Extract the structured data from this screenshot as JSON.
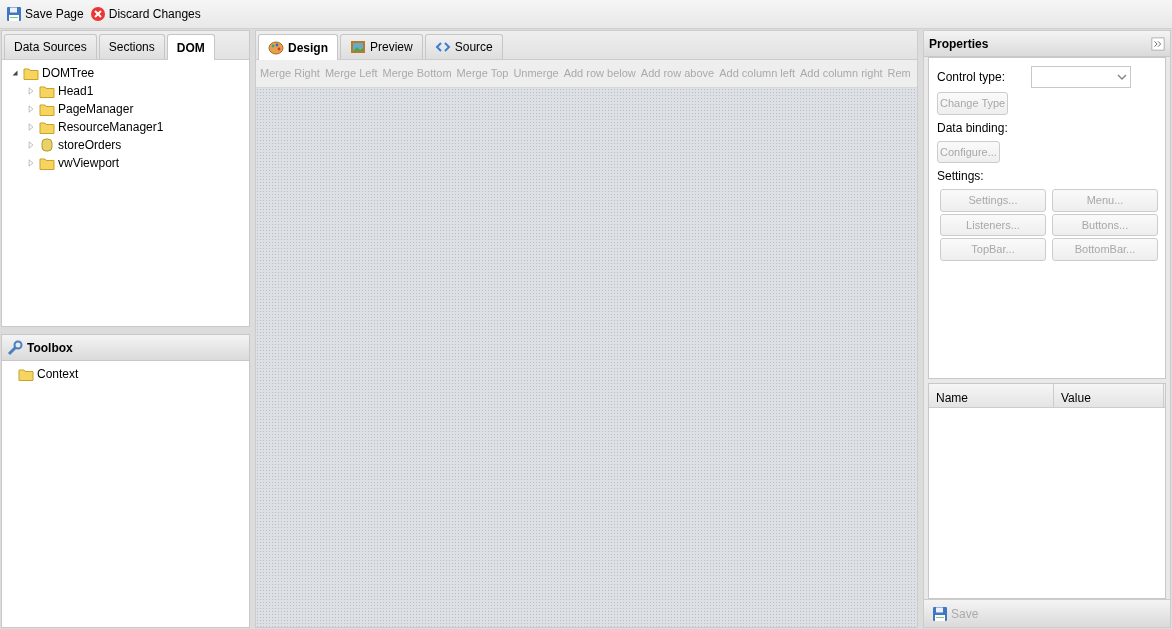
{
  "toolbar": {
    "buttons": [
      {
        "kind": "save",
        "label": "Save Page"
      },
      {
        "kind": "discard",
        "label": "Discard Changes"
      }
    ]
  },
  "left_tabs": [
    {
      "label": "Data Sources",
      "selected": false
    },
    {
      "label": "Sections",
      "selected": false
    },
    {
      "label": "DOM",
      "selected": true
    }
  ],
  "dom_tree": {
    "label": "DOMTree",
    "kind": "folder",
    "expanded": true,
    "children": [
      {
        "label": "Head1",
        "kind": "folder",
        "expanded": false
      },
      {
        "label": "PageManager",
        "kind": "folder",
        "expanded": false
      },
      {
        "label": "ResourceManager1",
        "kind": "folder",
        "expanded": false
      },
      {
        "label": "storeOrders",
        "kind": "store",
        "expanded": false
      },
      {
        "label": "vwViewport",
        "kind": "folder",
        "expanded": false
      }
    ]
  },
  "toolbox": {
    "title": "Toolbox",
    "items": [
      {
        "label": "Context",
        "kind": "folder"
      }
    ]
  },
  "editor_tabs": [
    {
      "label": "Design",
      "kind": "palette",
      "selected": true
    },
    {
      "label": "Preview",
      "kind": "picture",
      "selected": false
    },
    {
      "label": "Source",
      "kind": "code",
      "selected": false
    }
  ],
  "editor_toolbar": [
    {
      "label": "Merge Right",
      "disabled": true
    },
    {
      "label": "Merge Left",
      "disabled": true
    },
    {
      "label": "Merge Bottom",
      "disabled": true
    },
    {
      "label": "Merge Top",
      "disabled": true
    },
    {
      "label": "Unmerge",
      "disabled": true
    },
    {
      "label": "Add row below",
      "disabled": true
    },
    {
      "label": "Add row above",
      "disabled": true
    },
    {
      "label": "Add column left",
      "disabled": true
    },
    {
      "label": "Add column right",
      "disabled": true
    },
    {
      "label": "Rem",
      "disabled": true
    }
  ],
  "properties": {
    "title": "Properties",
    "control_type_label": "Control type:",
    "change_type": {
      "label": "Change Type",
      "disabled": true
    },
    "data_binding_label": "Data binding:",
    "configure": {
      "label": "Configure...",
      "disabled": true
    },
    "settings_label": "Settings:",
    "settings_buttons": [
      {
        "label": "Settings...",
        "disabled": true
      },
      {
        "label": "Menu...",
        "disabled": true
      },
      {
        "label": "Listeners...",
        "disabled": true
      },
      {
        "label": "Buttons...",
        "disabled": true
      },
      {
        "label": "TopBar...",
        "disabled": true
      },
      {
        "label": "BottomBar...",
        "disabled": true
      }
    ]
  },
  "property_grid": {
    "columns": [
      "Name",
      "Value"
    ]
  },
  "save_button": {
    "label": "Save",
    "disabled": true
  }
}
